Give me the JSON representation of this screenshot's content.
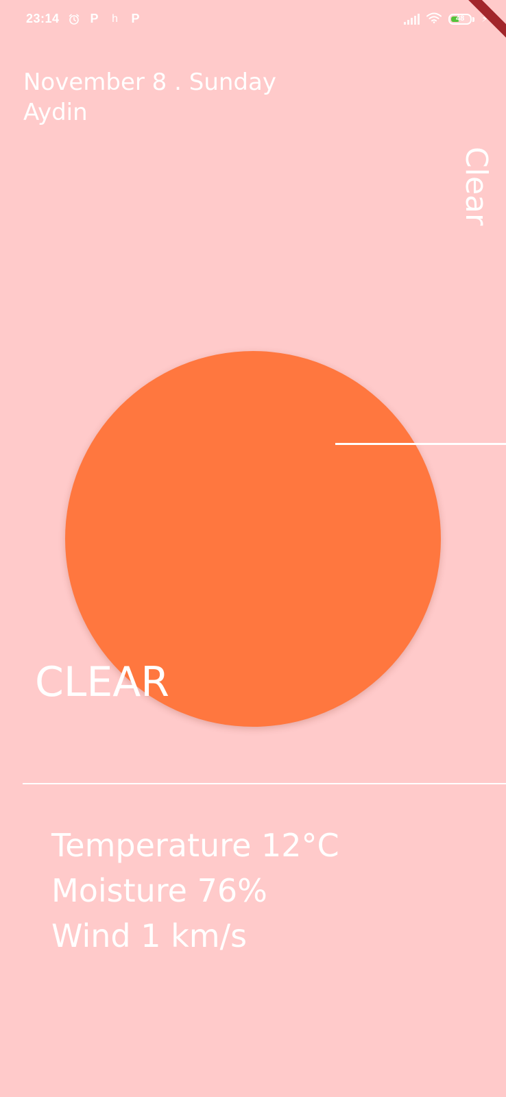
{
  "status_bar": {
    "time": "23:14",
    "notification_icons": [
      "alarm-icon",
      "p-app-icon",
      "h-app-icon",
      "p-app-icon"
    ],
    "notification_letters": [
      "P",
      "h",
      "P"
    ],
    "battery_level": "48",
    "battery_fraction": 0.48,
    "battery_color": "#55c23a"
  },
  "header": {
    "date": "November 8 . Sunday",
    "city": "Aydin"
  },
  "weather": {
    "condition_vertical": "Clear",
    "condition_big": "CLEAR",
    "sun_color": "#FF773F",
    "background_color": "#FFCACA"
  },
  "stats": {
    "temperature": "Temperature 12°C",
    "moisture": "Moisture 76%",
    "wind": "Wind 1 km/s"
  }
}
